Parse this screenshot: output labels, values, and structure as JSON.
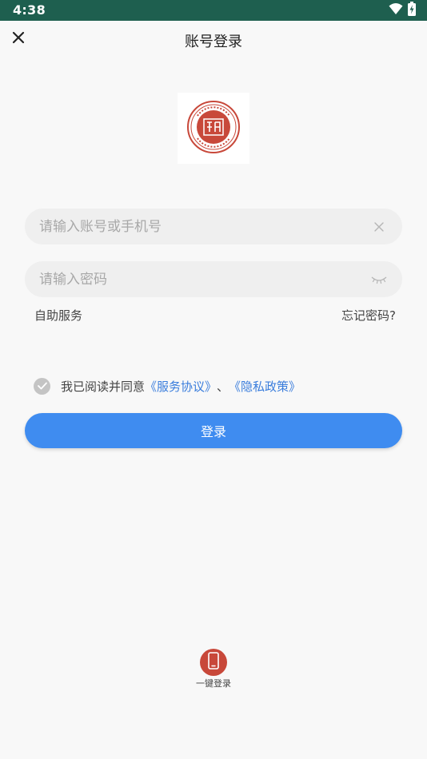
{
  "status_bar": {
    "time": "4:38",
    "wifi_icon": "wifi-icon",
    "battery_icon": "battery-charging-icon",
    "background_color": "#1e5f4f"
  },
  "nav": {
    "title": "账号登录",
    "close_icon": "close-icon"
  },
  "logo": {
    "icon": "school-seal-logo-icon",
    "color": "#c8483a"
  },
  "account": {
    "value": "",
    "placeholder": "请输入账号或手机号",
    "clear_icon": "clear-icon"
  },
  "password": {
    "value": "",
    "placeholder": "请输入密码",
    "toggle_icon": "eye-closed-icon"
  },
  "links": {
    "self_service": "自助服务",
    "forgot_password": "忘记密码?"
  },
  "agreement": {
    "prefix": "我已阅读并同意",
    "service_agreement": "《服务协议》",
    "separator": "、",
    "privacy_policy": "《隐私政策》",
    "checked_color": "#c4c4c4",
    "link_color": "#3a7ddc"
  },
  "login_button": {
    "label": "登录",
    "color": "#3f8cf0"
  },
  "one_key_login": {
    "label": "一键登录",
    "icon": "phone-icon",
    "color": "#c8483a"
  }
}
